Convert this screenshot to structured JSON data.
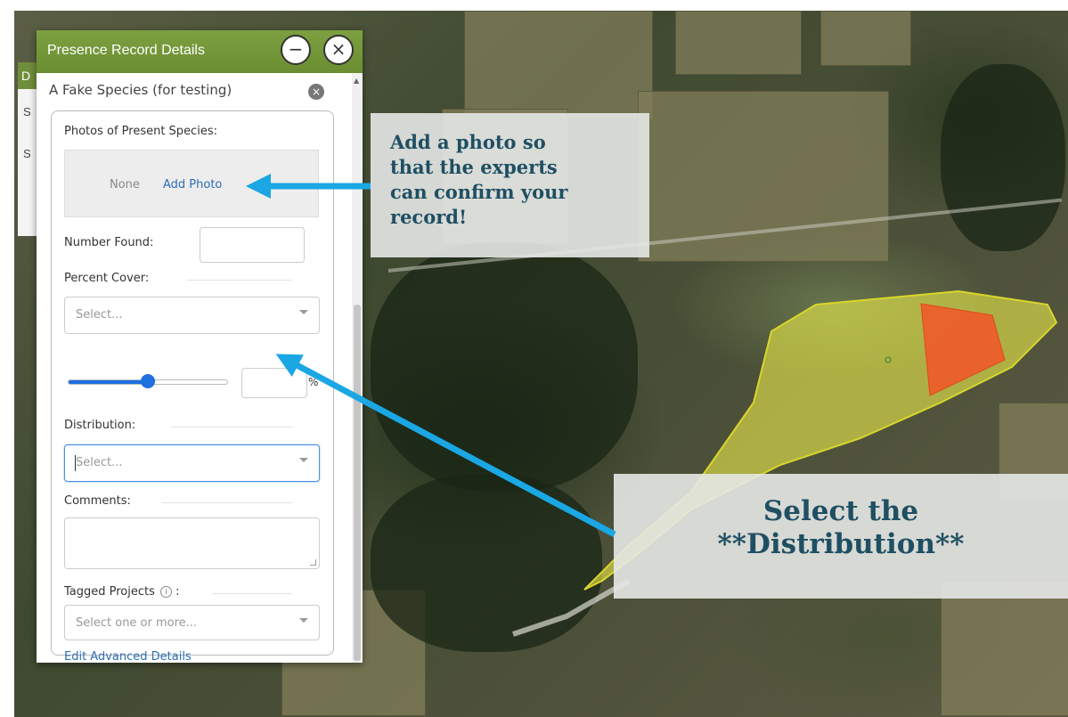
{
  "panel": {
    "title": "Presence Record Details",
    "minimize_glyph": "−",
    "close_glyph": "×",
    "species_name": "A Fake Species (for testing)",
    "species_clear_glyph": "×",
    "photos_label": "Photos of Present Species:",
    "photos_none": "None",
    "add_photo": "Add Photo",
    "number_found_label": "Number Found:",
    "number_found_value": "",
    "percent_cover_label": "Percent Cover:",
    "percent_cover_placeholder": "Select...",
    "percent_cover_slider_fraction": 0.5,
    "percent_value": "",
    "percent_symbol": "%",
    "distribution_label": "Distribution:",
    "distribution_placeholder": "Select...",
    "comments_label": "Comments:",
    "comments_value": "",
    "tagged_projects_label": "Tagged Projects",
    "tagged_projects_suffix": " :",
    "tagged_projects_placeholder": "Select one or more...",
    "edit_advanced": "Edit Advanced Details"
  },
  "sidebar_stub": {
    "header_letter": "D",
    "row1": "S",
    "row2": "S"
  },
  "callouts": {
    "add_photo_tip": [
      "Add a photo so",
      "that the experts",
      "can confirm your",
      "record!"
    ],
    "distribution_tip": [
      "Select the",
      "**Distribution**"
    ]
  },
  "colors": {
    "panel_header": "#6f8e3a",
    "link": "#2e6db4",
    "arrow": "#1aa7e4",
    "callout_text": "#1f4f63",
    "polygon_yellow": "#e6e84a",
    "polygon_red": "#f05a2a",
    "slider": "#1e6fe0"
  },
  "icons": [
    "minimize-icon",
    "close-icon",
    "clear-icon",
    "chevron-down-icon",
    "info-icon",
    "arrow-icon"
  ]
}
